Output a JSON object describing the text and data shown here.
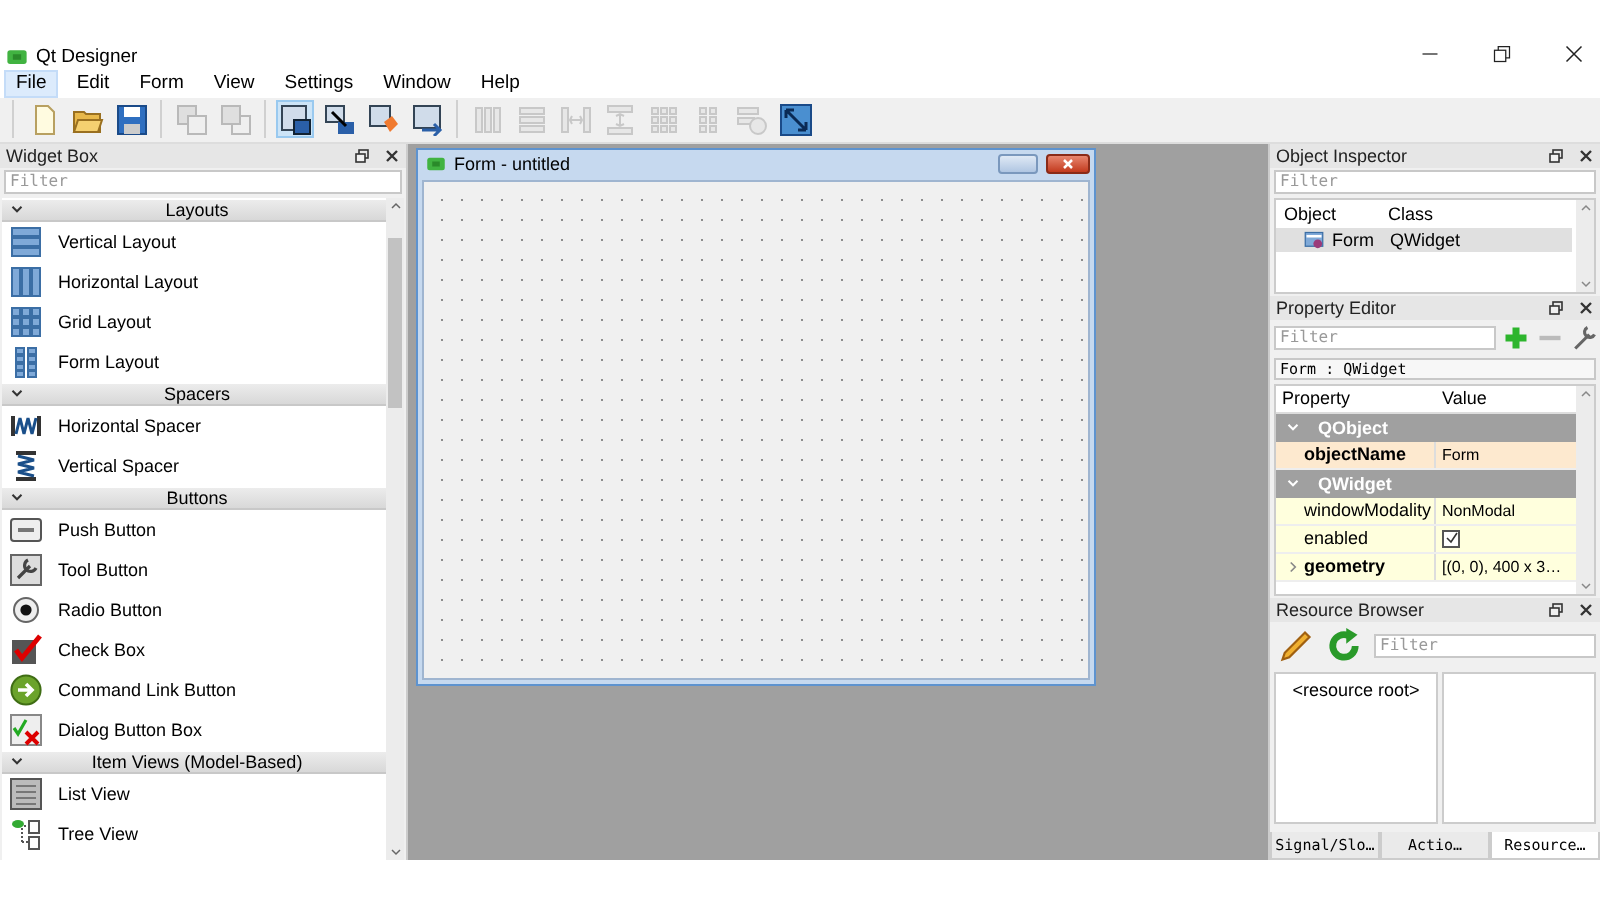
{
  "window": {
    "title": "Qt Designer"
  },
  "menu": [
    {
      "label": "File",
      "selected": true
    },
    {
      "label": "Edit",
      "selected": false
    },
    {
      "label": "Form",
      "selected": false
    },
    {
      "label": "View",
      "selected": false
    },
    {
      "label": "Settings",
      "selected": false
    },
    {
      "label": "Window",
      "selected": false
    },
    {
      "label": "Help",
      "selected": false
    }
  ],
  "toolbar": [
    {
      "items": [
        {
          "kind": "new",
          "disabled": false,
          "selected": false
        },
        {
          "kind": "open",
          "disabled": false,
          "selected": false
        },
        {
          "kind": "save",
          "disabled": false,
          "selected": false
        }
      ]
    },
    {
      "items": [
        {
          "kind": "send-back",
          "disabled": true,
          "selected": false
        },
        {
          "kind": "bring-front",
          "disabled": true,
          "selected": false
        }
      ]
    },
    {
      "items": [
        {
          "kind": "edit-widgets",
          "disabled": false,
          "selected": true
        },
        {
          "kind": "edit-signals",
          "disabled": false,
          "selected": false
        },
        {
          "kind": "edit-buddies",
          "disabled": false,
          "selected": false
        },
        {
          "kind": "edit-taborder",
          "disabled": false,
          "selected": false
        }
      ]
    },
    {
      "items": [
        {
          "kind": "layout-h",
          "disabled": true,
          "selected": false
        },
        {
          "kind": "layout-v",
          "disabled": true,
          "selected": false
        },
        {
          "kind": "splitter-h",
          "disabled": true,
          "selected": false
        },
        {
          "kind": "splitter-v",
          "disabled": true,
          "selected": false
        },
        {
          "kind": "layout-grid",
          "disabled": true,
          "selected": false
        },
        {
          "kind": "layout-form",
          "disabled": true,
          "selected": false
        },
        {
          "kind": "break-layout",
          "disabled": true,
          "selected": false
        },
        {
          "kind": "adjust-size",
          "disabled": false,
          "selected": false
        }
      ]
    }
  ],
  "widget_box": {
    "title": "Widget Box",
    "filter": {
      "placeholder": "Filter"
    },
    "categories": [
      {
        "label": "Layouts",
        "expanded": true,
        "items": [
          {
            "label": "Vertical Layout",
            "kind": "vertical-layout"
          },
          {
            "label": "Horizontal Layout",
            "kind": "horizontal-layout"
          },
          {
            "label": "Grid Layout",
            "kind": "grid-layout"
          },
          {
            "label": "Form Layout",
            "kind": "form-layout"
          }
        ]
      },
      {
        "label": "Spacers",
        "expanded": true,
        "items": [
          {
            "label": "Horizontal Spacer",
            "kind": "horizontal-spacer"
          },
          {
            "label": "Vertical Spacer",
            "kind": "vertical-spacer"
          }
        ]
      },
      {
        "label": "Buttons",
        "expanded": true,
        "items": [
          {
            "label": "Push Button",
            "kind": "push-button"
          },
          {
            "label": "Tool Button",
            "kind": "tool-button"
          },
          {
            "label": "Radio Button",
            "kind": "radio-button"
          },
          {
            "label": "Check Box",
            "kind": "check-box"
          },
          {
            "label": "Command Link Button",
            "kind": "command-link"
          },
          {
            "label": "Dialog Button Box",
            "kind": "dialog-button-box"
          }
        ]
      },
      {
        "label": "Item Views (Model-Based)",
        "expanded": true,
        "items": [
          {
            "label": "List View",
            "kind": "list-view"
          },
          {
            "label": "Tree View",
            "kind": "tree-view"
          }
        ]
      }
    ]
  },
  "form_window": {
    "title": "Form - untitled"
  },
  "object_inspector": {
    "title": "Object Inspector",
    "filter": {
      "placeholder": "Filter"
    },
    "columns": [
      "Object",
      "Class"
    ],
    "rows": [
      {
        "object": "Form",
        "class": "QWidget",
        "selected": true
      }
    ]
  },
  "property_editor": {
    "title": "Property Editor",
    "filter": {
      "placeholder": "Filter"
    },
    "context": "Form : QWidget",
    "columns": [
      "Property",
      "Value"
    ],
    "groups": [
      {
        "name": "QObject",
        "expanded": true,
        "properties": [
          {
            "name": "objectName",
            "kind": "text",
            "value": "Form",
            "changed": true
          }
        ]
      },
      {
        "name": "QWidget",
        "expanded": true,
        "properties": [
          {
            "name": "windowModality",
            "kind": "text",
            "value": "NonModal",
            "changed": false
          },
          {
            "name": "enabled",
            "kind": "checkbox",
            "checked": true,
            "changed": false
          },
          {
            "name": "geometry",
            "kind": "compound",
            "value": "[(0, 0), 400 x 3…",
            "changed": true,
            "expanded": false
          }
        ]
      }
    ]
  },
  "resource_browser": {
    "title": "Resource Browser",
    "filter": {
      "placeholder": "Filter"
    },
    "root": "<resource root>"
  },
  "bottom_tabs": [
    {
      "label": "Signal/Slo…",
      "selected": false
    },
    {
      "label": "Actio…",
      "selected": false
    },
    {
      "label": "Resource…",
      "selected": true
    }
  ]
}
